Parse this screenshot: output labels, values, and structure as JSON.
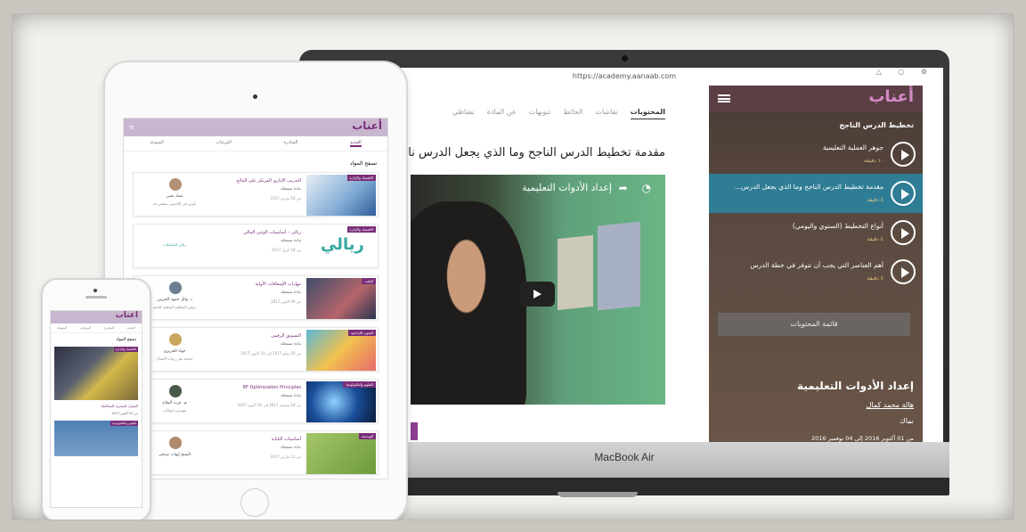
{
  "laptop": {
    "url": "https://academy.aanaab.com",
    "brand": "MacBook Air",
    "tabs": [
      "المحتويات",
      "نقاشات",
      "الحائط",
      "تنويهات",
      "عن المادة",
      "نشاطي"
    ],
    "lesson_title": "مقدمة تخطيط الدرس الناجح وما الذي يجعل الدرس نا",
    "video_title": "إعداد الأدوات التعليمية",
    "sidebar": {
      "logo": "أعناب",
      "heading": "تخطيط الدرس الناجح",
      "items": [
        {
          "label": "جوهر العملية التعليمية",
          "time": "١٠ دقيقة",
          "active": false
        },
        {
          "label": "مقدمة تخطيط الدرس الناجح وما الذي يجعل الدرس...",
          "time": "٤ دقيقة",
          "active": true
        },
        {
          "label": "أنواع التخطيط (السنوي واليومي)",
          "time": "٤ دقيقة",
          "active": false
        },
        {
          "label": "أهم العناصر التي يجب أن تتوفر في خطة الدرس",
          "time": "٤ دقيقة",
          "active": false
        }
      ],
      "contents_button": "قائمة المحتويات",
      "course_title": "إعداد الأدوات التعليمية",
      "teacher": "هالة محمد كمال",
      "location": "نماك",
      "dates": "من 01 أكتوبر 2016 إلى 04 نوفمبر 2016"
    }
  },
  "tablet": {
    "logo": "أعناب",
    "tabs": [
      "الجديد",
      "المبادرة",
      "المرئيات",
      "المنوعة"
    ],
    "section_title": "تصفح المواد",
    "cards": [
      {
        "tag": "الاقتصاد والإدارة",
        "title": "التدريب الإداري المرتكز على النتائج",
        "meta": "مادة مسجلة",
        "date": "من 18 مارس 2017",
        "author": "عماد يحيى",
        "sub": "تأتيني في أكاديمي، معلمي قد"
      },
      {
        "tag": "الاقتصاد والإدارة",
        "title": "ريالي – أساسيات الوعي المالي",
        "meta": "مادة مسجلة",
        "date": "من 18 أبريل 2017",
        "author": "ريالي",
        "sub": "ريالي للمعاملات"
      },
      {
        "tag": "الطب",
        "title": "مهارات الإسعافات الأولية",
        "meta": "مادة مسجلة",
        "date": "من 09 أكتوبر 2017",
        "author": "د. وائل حمود الحزبين",
        "sub": "رئيس المنظمة الوطنية للدعم"
      },
      {
        "tag": "الفنون الإبداعية",
        "title": "التسويق الرقمي",
        "meta": "مادة مسجلة",
        "date": "من 10 يوليو 2017 إلى 10 أكتوبر 2017",
        "author": "جهاد الحريزي",
        "sub": "جامعة على ريادة الأعمال"
      },
      {
        "tag": "العلوم والتكنولوجيا",
        "title": "RF Optimization Principles",
        "meta": "مادة مسجلة",
        "date": "من 18 سبتمبر 2017 إلى 10 أكتوبر 2017",
        "author": "م. عزت الملاح",
        "sub": "مهندس اتصالات"
      },
      {
        "tag": "الهندسة",
        "title": "أساسيات الكتابة",
        "meta": "مادة مسجلة",
        "date": "من 13 مارس 2017",
        "author": "الشيخ إيهاب صدقي",
        "sub": ""
      }
    ]
  },
  "phone": {
    "logo": "أعناب",
    "tabs": [
      "الجديد",
      "المبادرة",
      "المرئيات",
      "المنوعة"
    ],
    "section_title": "تصفح المواد",
    "card1_tag": "الاقتصاد والإدارة",
    "card1_title": "الموارد البشرية المتكاملة",
    "card1_sub": "من 01 أكتوبر 2017",
    "card2_tag": "العلوم والتكنولوجيا"
  }
}
